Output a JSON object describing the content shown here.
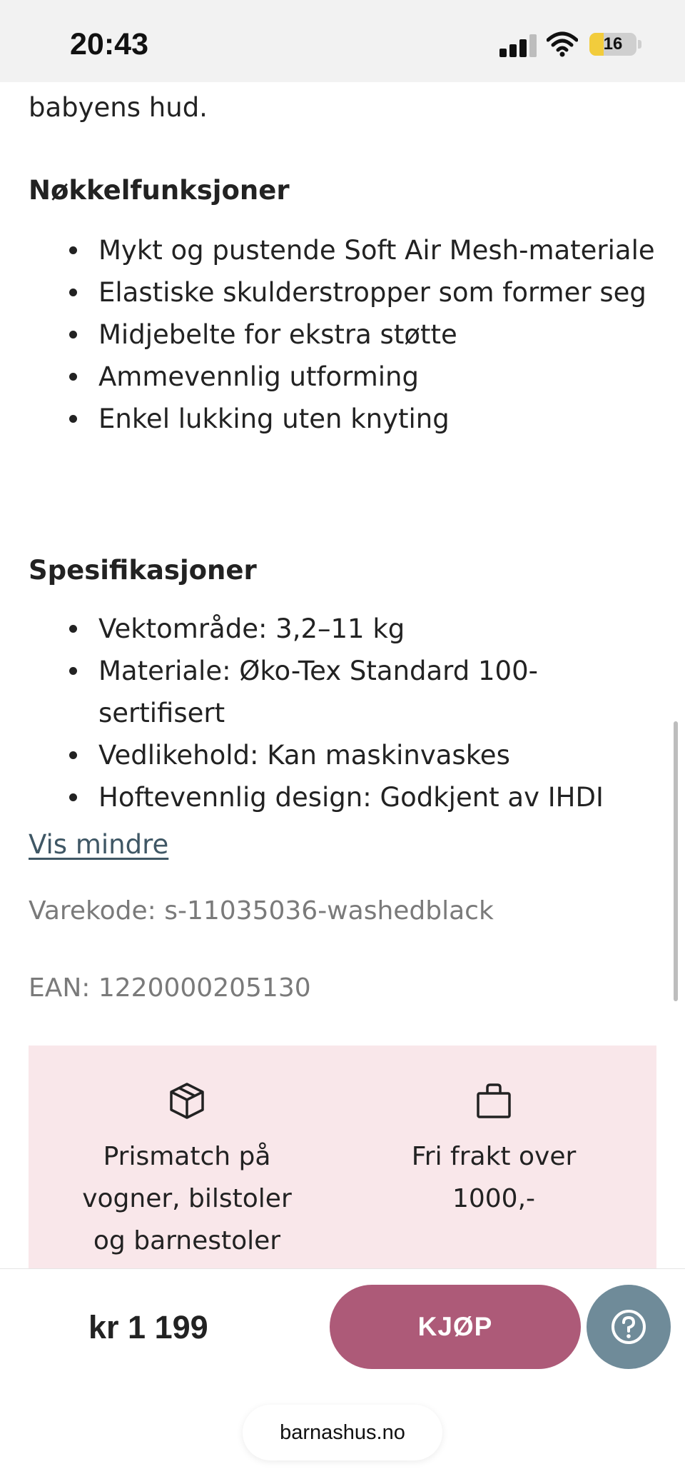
{
  "status_bar": {
    "time": "20:43",
    "battery_level": "16",
    "battery_color": "#f2cc3c"
  },
  "description": {
    "intro_tail": "babyens hud.",
    "features": {
      "heading": "Nøkkelfunksjoner",
      "items": [
        "Mykt og pustende Soft Air Mesh-materiale",
        "Elastiske skulderstropper som former seg",
        "Midjebelte for ekstra støtte",
        "Ammevennlig utforming",
        "Enkel lukking uten knyting"
      ]
    },
    "specs": {
      "heading": "Spesifikasjoner",
      "items": [
        "Vektområde: 3,2–11 kg",
        "Materiale: Øko-Tex Standard 100-sertifisert",
        "Vedlikehold: Kan maskinvaskes",
        "Hoftevennlig design: Godkjent av IHDI"
      ]
    },
    "show_less": "Vis mindre"
  },
  "product_meta": {
    "sku": "Varekode: s-11035036-washedblack",
    "ean": "EAN: 1220000205130"
  },
  "benefits": [
    {
      "icon": "package-icon",
      "text": "Prismatch på vogner, bilstoler og barnestoler"
    },
    {
      "icon": "shopping-bag-icon",
      "text": "Fri frakt over 1000,-"
    }
  ],
  "purchase_bar": {
    "price": "kr 1 199",
    "buy_label": "KJØP",
    "help_icon": "question-icon",
    "accent_color": "#ad5a78"
  },
  "browser": {
    "url": "barnashus.no"
  }
}
